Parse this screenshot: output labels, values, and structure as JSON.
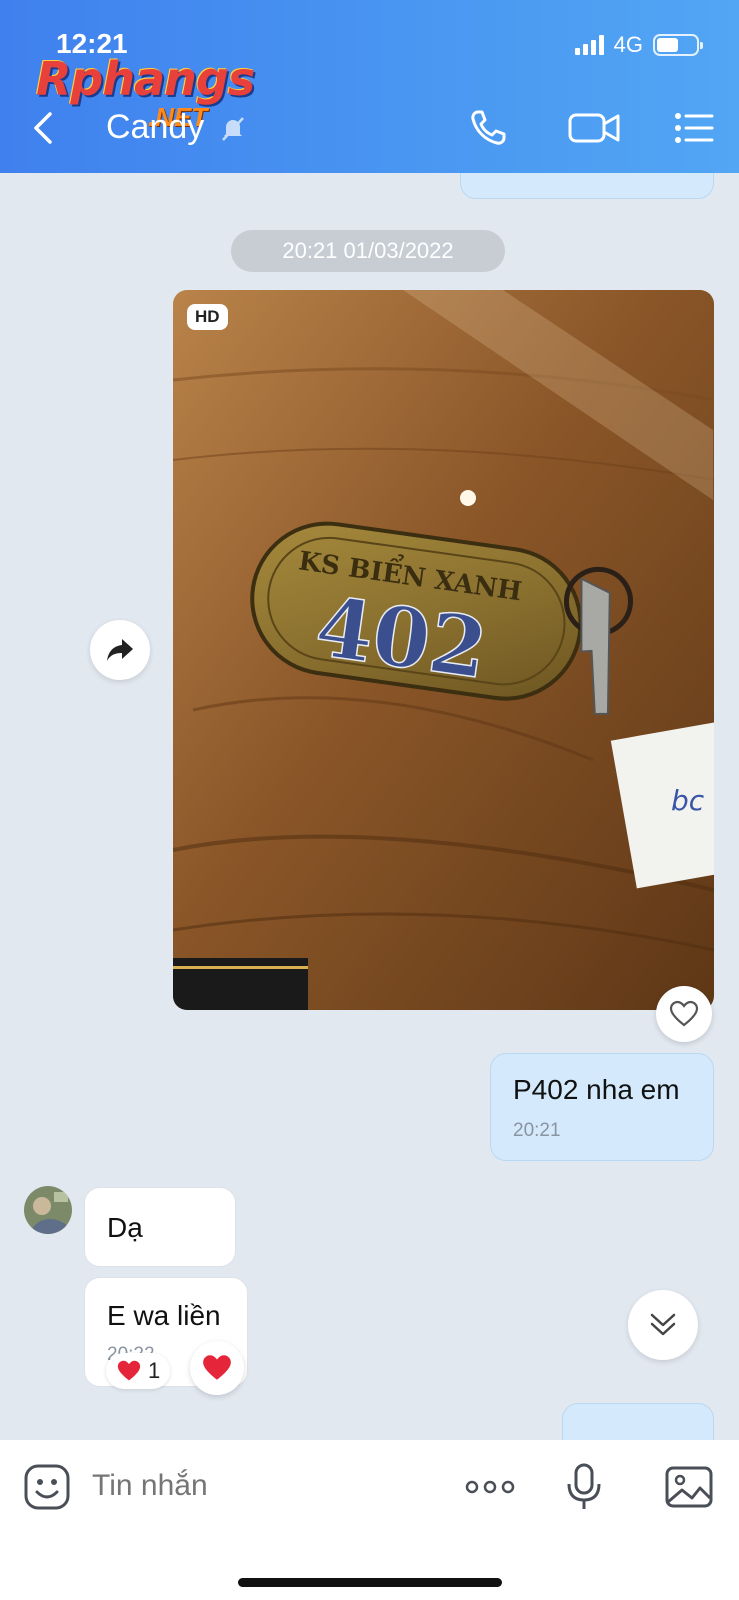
{
  "status_bar": {
    "time": "12:21",
    "network": "4G",
    "battery_level": 0.55
  },
  "watermark": {
    "main": "Rphangs",
    "sub": ".NET"
  },
  "header": {
    "contact_name": "Candy",
    "back_icon": "chevron-left-icon",
    "call_icon": "phone-icon",
    "video_icon": "video-camera-icon",
    "menu_icon": "list-menu-icon",
    "mute_icon": "bell-muted-icon"
  },
  "chat": {
    "date_separator": "20:21 01/03/2022",
    "photo": {
      "badge": "HD",
      "tag_text": "KS BIỂN XANH",
      "tag_number": "402",
      "note_text": "bc"
    },
    "outgoing": {
      "text": "P402 nha em",
      "time": "20:21"
    },
    "incoming": [
      {
        "text": "Dạ"
      },
      {
        "text": "E wa liền",
        "time": "20:22"
      }
    ],
    "reaction": {
      "emoji": "❤️",
      "count": "1"
    }
  },
  "composer": {
    "placeholder": "Tin nhắn"
  },
  "colors": {
    "header": "#4a98f2",
    "outgoing_bubble": "#d4eafc",
    "chat_bg": "#e2e8f0",
    "heart": "#e5253a"
  }
}
